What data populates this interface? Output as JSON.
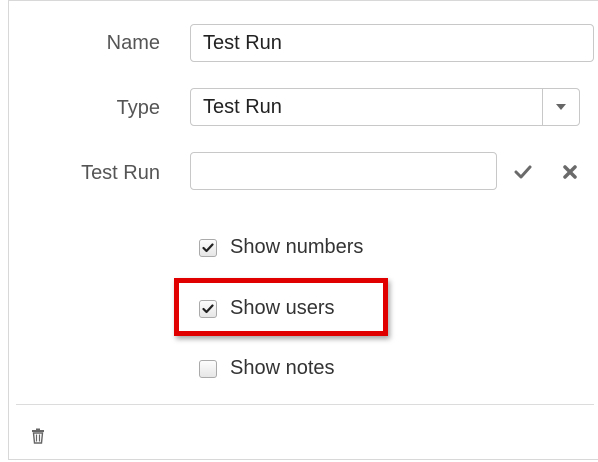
{
  "form": {
    "name_label": "Name",
    "name_value": "Test Run",
    "type_label": "Type",
    "type_value": "Test Run",
    "testrun_label": "Test Run",
    "testrun_value": ""
  },
  "options": [
    {
      "label": "Show numbers",
      "checked": true
    },
    {
      "label": "Show users",
      "checked": true
    },
    {
      "label": "Show notes",
      "checked": false
    }
  ],
  "icons": {
    "select_arrow": "chevron-down-icon",
    "confirm": "check-icon",
    "cancel": "close-icon",
    "delete": "trash-icon"
  },
  "colors": {
    "highlight": "#e00000"
  }
}
